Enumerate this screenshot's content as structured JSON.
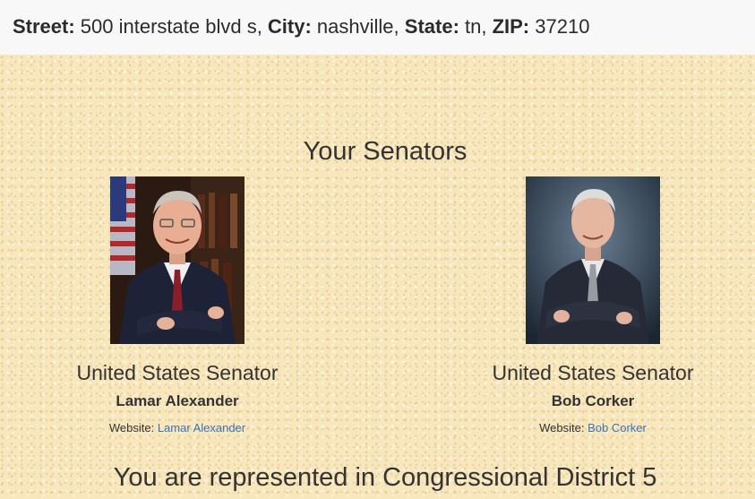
{
  "address": {
    "street_label": "Street:",
    "street_value": " 500 interstate blvd s, ",
    "city_label": "City:",
    "city_value": " nashville, ",
    "state_label": "State:",
    "state_value": " tn, ",
    "zip_label": "ZIP:",
    "zip_value": " 37210"
  },
  "senators_section": {
    "title": "Your Senators",
    "senators": [
      {
        "role": "United States Senator",
        "name": "Lamar Alexander",
        "website_label": "Website: ",
        "website_link": "Lamar Alexander"
      },
      {
        "role": "United States Senator",
        "name": "Bob Corker",
        "website_label": "Website: ",
        "website_link": "Bob Corker"
      }
    ]
  },
  "district": {
    "text": "You are represented in Congressional District 5"
  },
  "colors": {
    "link": "#3a74b8",
    "background": "#f8e6bc",
    "header_bg": "#f8f8f8"
  }
}
